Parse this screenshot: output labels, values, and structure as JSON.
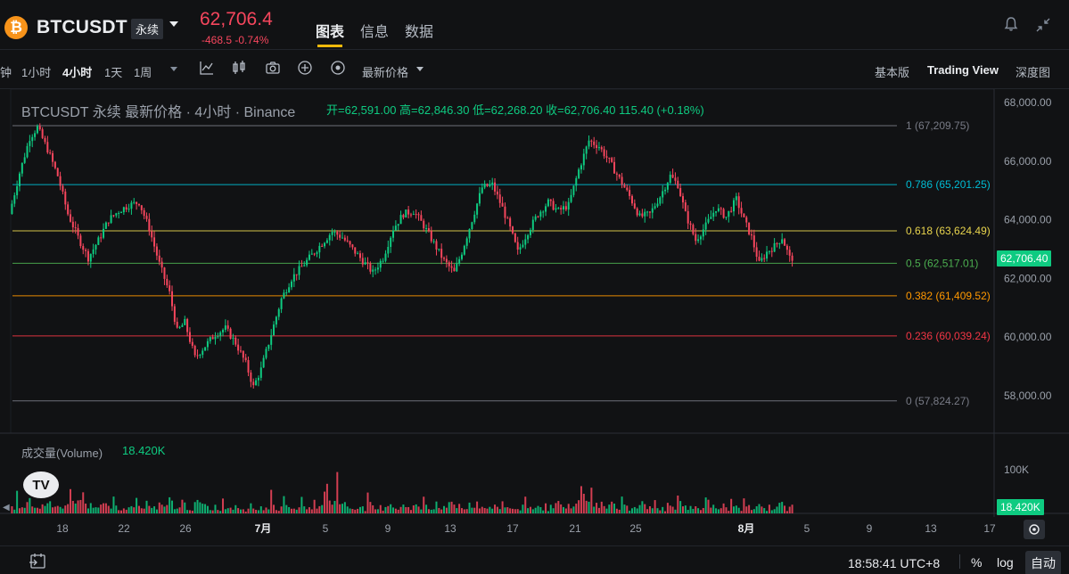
{
  "header": {
    "logo_glyph": "₿",
    "symbol": "BTCUSDT",
    "contract_type": "永续",
    "last_price": "62,706.4",
    "change": "-468.5 -0.74%",
    "tabs": [
      "图表",
      "信息",
      "数据"
    ],
    "icons": [
      "bell-icon",
      "collapse-icon"
    ]
  },
  "toolbar": {
    "timeframes": [
      "钟",
      "1小时",
      "4小时",
      "1天",
      "1周"
    ],
    "active_timeframe": "4小时",
    "price_type": "最新价格",
    "icons": [
      "indicator-icon",
      "candle-type-icon",
      "camera-icon",
      "add-icon",
      "settings-circle-icon"
    ],
    "views": [
      "基本版",
      "Trading View",
      "深度图"
    ],
    "active_view": "Trading View"
  },
  "legend": {
    "title": "BTCUSDT 永续 最新价格 · 4小时 · Binance",
    "ohlc": "开=62,591.00  高=62,846.30  低=62,268.20  收=62,706.40  115.40 (+0.18%)"
  },
  "volume": {
    "label": "成交量(Volume)",
    "value": "18.420K",
    "axis_label": "100K"
  },
  "chart_data": {
    "type": "candlestick",
    "y_axis_ticks": [
      "68,000.00",
      "66,000.00",
      "64,000.00",
      "62,000.00",
      "60,000.00",
      "58,000.00"
    ],
    "ylim": [
      57400,
      68200
    ],
    "current_price_tag": "62,706.40",
    "x_ticks": [
      "18",
      "22",
      "26",
      "7月",
      "5",
      "9",
      "13",
      "17",
      "21",
      "25",
      "8月",
      "5",
      "9",
      "13",
      "17"
    ],
    "fib_levels": [
      {
        "label": "1 (67,209.75)",
        "value": 67209.75,
        "color": "#787b86"
      },
      {
        "label": "0.786 (65,201.25)",
        "value": 65201.25,
        "color": "#00bcd4"
      },
      {
        "label": "0.618 (63,624.49)",
        "value": 63624.49,
        "color": "#e8d44d"
      },
      {
        "label": "0.5 (62,517.01)",
        "value": 62517.01,
        "color": "#4caf50"
      },
      {
        "label": "0.382 (61,409.52)",
        "value": 61409.52,
        "color": "#ff9800"
      },
      {
        "label": "0.236 (60,039.24)",
        "value": 60039.24,
        "color": "#f23645"
      },
      {
        "label": "0 (57,824.27)",
        "value": 57824.27,
        "color": "#787b86"
      }
    ],
    "price_path": [
      [
        0,
        64200
      ],
      [
        4,
        65600
      ],
      [
        8,
        66800
      ],
      [
        11,
        67150
      ],
      [
        15,
        66400
      ],
      [
        19,
        65500
      ],
      [
        23,
        64200
      ],
      [
        27,
        63400
      ],
      [
        31,
        62700
      ],
      [
        35,
        63300
      ],
      [
        39,
        64000
      ],
      [
        43,
        64300
      ],
      [
        47,
        64500
      ],
      [
        51,
        64600
      ],
      [
        55,
        63700
      ],
      [
        59,
        62500
      ],
      [
        63,
        61500
      ],
      [
        66,
        60200
      ],
      [
        69,
        60500
      ],
      [
        73,
        59300
      ],
      [
        77,
        59700
      ],
      [
        81,
        60100
      ],
      [
        85,
        60300
      ],
      [
        89,
        59800
      ],
      [
        93,
        59100
      ],
      [
        96,
        58300
      ],
      [
        99,
        58900
      ],
      [
        103,
        60100
      ],
      [
        107,
        61300
      ],
      [
        111,
        62000
      ],
      [
        115,
        62400
      ],
      [
        119,
        62800
      ],
      [
        123,
        63200
      ],
      [
        127,
        63600
      ],
      [
        131,
        63400
      ],
      [
        135,
        63000
      ],
      [
        139,
        62600
      ],
      [
        143,
        62200
      ],
      [
        147,
        62700
      ],
      [
        151,
        63700
      ],
      [
        155,
        64200
      ],
      [
        159,
        64300
      ],
      [
        163,
        63800
      ],
      [
        167,
        63200
      ],
      [
        171,
        62600
      ],
      [
        175,
        62200
      ],
      [
        178,
        62900
      ],
      [
        182,
        64000
      ],
      [
        186,
        65100
      ],
      [
        190,
        65200
      ],
      [
        194,
        64400
      ],
      [
        197,
        63700
      ],
      [
        200,
        62900
      ],
      [
        204,
        63600
      ],
      [
        208,
        64200
      ],
      [
        212,
        64600
      ],
      [
        216,
        64300
      ],
      [
        220,
        64500
      ],
      [
        224,
        65700
      ],
      [
        228,
        66700
      ],
      [
        232,
        66500
      ],
      [
        236,
        66000
      ],
      [
        240,
        65400
      ],
      [
        244,
        64800
      ],
      [
        248,
        64100
      ],
      [
        252,
        64200
      ],
      [
        256,
        64800
      ],
      [
        260,
        65500
      ],
      [
        263,
        65200
      ],
      [
        266,
        64200
      ],
      [
        270,
        63300
      ],
      [
        274,
        63800
      ],
      [
        278,
        64400
      ],
      [
        282,
        64100
      ],
      [
        286,
        64700
      ],
      [
        289,
        64000
      ],
      [
        292,
        63400
      ],
      [
        295,
        62500
      ],
      [
        298,
        62900
      ],
      [
        301,
        63100
      ],
      [
        304,
        63400
      ],
      [
        307,
        62700
      ]
    ],
    "volume_bars": [
      12,
      18,
      40,
      20,
      15,
      10,
      25,
      30,
      14,
      11,
      22,
      9,
      16,
      13,
      28,
      35,
      15,
      12,
      19,
      24,
      11,
      18,
      30,
      45,
      60,
      38,
      22,
      55,
      85,
      30,
      18,
      25,
      20,
      14,
      12,
      15,
      22,
      17,
      13,
      10,
      35,
      20,
      14,
      11,
      9,
      15,
      12,
      18,
      24,
      30,
      16,
      13,
      11,
      26,
      19,
      14,
      12,
      10,
      21,
      17,
      13,
      15,
      42,
      25,
      18,
      14,
      12,
      28,
      21,
      16,
      13,
      11,
      19,
      30,
      24,
      17,
      22,
      15,
      12,
      10,
      18,
      14,
      11,
      27,
      20,
      16,
      13,
      12,
      25,
      19,
      15,
      11,
      9,
      22,
      17,
      14,
      12,
      10,
      16,
      13
    ]
  },
  "statusbar": {
    "clock": "18:58:41 UTC+8",
    "percent": "%",
    "log": "log",
    "auto": "自动"
  }
}
